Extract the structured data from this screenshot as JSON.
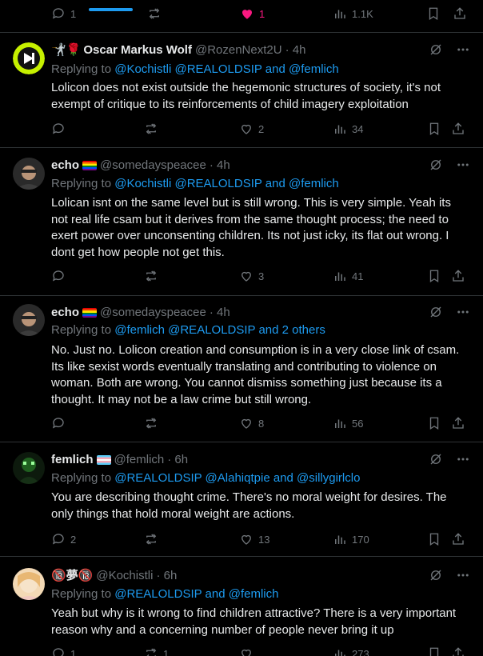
{
  "top_actions": {
    "reply": "1",
    "like": "1",
    "views": "1.1K"
  },
  "tweets": [
    {
      "prefix": "🤺🌹",
      "name": "Oscar Markus Wolf",
      "handle": "@RozenNext2U",
      "time": "· 4h",
      "replying_label": "Replying to",
      "replying_links": "@Kochistli @REALOLDSIP and @femlich",
      "text": "Lolicon does not exist outside the hegemonic structures of society, it's not exempt of critique to its reinforcements of child imagery exploitation",
      "replies": "",
      "reposts": "",
      "likes": "2",
      "views": "34"
    },
    {
      "name": "echo",
      "handle": "@somedayspeacee",
      "time": "· 4h",
      "replying_label": "Replying to",
      "replying_links": "@Kochistli @REALOLDSIP and @femlich",
      "text": "Lolican isnt on the same level but is still wrong. This is very simple. Yeah its not real life csam but it derives from the same thought process; the need to exert power over unconsenting children. Its not just icky, its flat out wrong. I dont get how people not get this.",
      "replies": "",
      "reposts": "",
      "likes": "3",
      "views": "41"
    },
    {
      "name": "echo",
      "handle": "@somedayspeacee",
      "time": "· 4h",
      "replying_label": "Replying to",
      "replying_links": "@femlich @REALOLDSIP and 2 others",
      "text": "No. Just no. Lolicon creation and consumption is in a very close link of csam. Its like sexist words eventually translating and contributing to violence on woman. Both are wrong. You cannot dismiss something just because its a thought. It may not be a law crime but still wrong.",
      "replies": "",
      "reposts": "",
      "likes": "8",
      "views": "56"
    },
    {
      "name": "femlich",
      "handle": "@femlich",
      "time": "· 6h",
      "replying_label": "Replying to",
      "replying_links": "@REALOLDSIP @Alahiqtpie and @sillygirlclo",
      "text": "You are describing thought crime. There's no moral weight for desires. The only things that hold moral weight are actions.",
      "replies": "2",
      "reposts": "",
      "likes": "13",
      "views": "170"
    },
    {
      "name": "🔞夢🔞",
      "handle": "@Kochistli",
      "time": "· 6h",
      "replying_label": "Replying to",
      "replying_links": "@REALOLDSIP and @femlich",
      "text": "Yeah but why is it wrong to find children attractive? There is a very important reason why and a concerning number of people never bring it up",
      "replies": "1",
      "reposts": "1",
      "likes": "",
      "views": "273"
    }
  ],
  "colors": {
    "background": "#000000",
    "text": "#e7e9ea",
    "muted": "#71767b",
    "link": "#1d9bf0",
    "divider": "#2f3336",
    "like_active": "#f91880"
  }
}
